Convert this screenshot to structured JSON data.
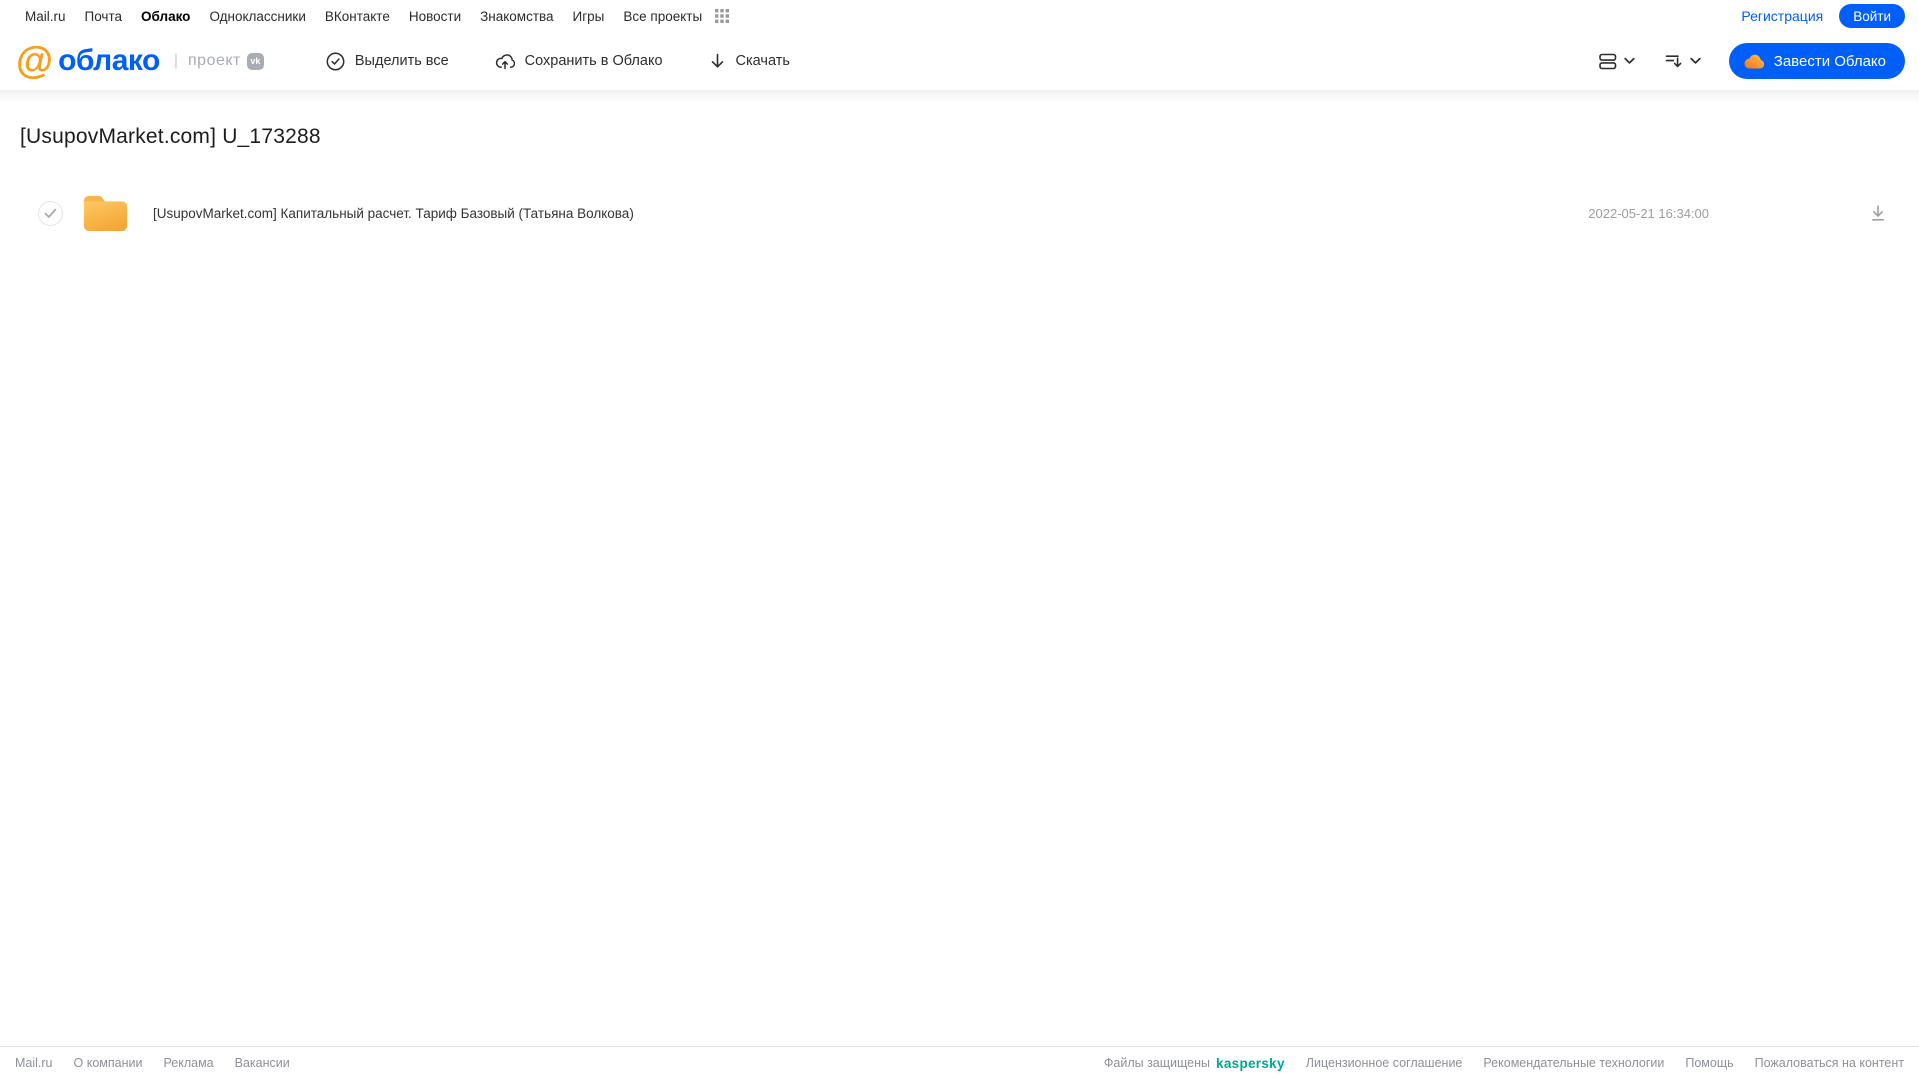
{
  "topnav": {
    "items": [
      "Mail.ru",
      "Почта",
      "Облако",
      "Одноклассники",
      "ВКонтакте",
      "Новости",
      "Знакомства",
      "Игры",
      "Все проекты"
    ],
    "active_item": "Облако",
    "registration_label": "Регистрация",
    "login_label": "Войти"
  },
  "header": {
    "logo": {
      "at_symbol": "@",
      "word": "облако",
      "project_label": "проект",
      "vk_badge": "vk"
    },
    "actions": [
      {
        "label": "Выделить все",
        "icon": "check-circle-icon"
      },
      {
        "label": "Сохранить в Облако",
        "icon": "cloud-upload-icon"
      },
      {
        "label": "Скачать",
        "icon": "download-arrow-icon"
      }
    ],
    "create_cloud_button": {
      "label": "Завести Облако",
      "icon": "cloud-icon"
    }
  },
  "page": {
    "title": "[UsupovMarket.com] U_173288"
  },
  "files": [
    {
      "type": "folder",
      "name": "[UsupovMarket.com] Капитальный расчет. Тариф Базовый (Татьяна Волкова)",
      "date": "2022-05-21 16:34:00"
    }
  ],
  "footer": {
    "left_links": [
      "Mail.ru",
      "О компании",
      "Реклама",
      "Вакансии"
    ],
    "protected_text": "Файлы защищены",
    "kaspersky_label": "kaspersky",
    "right_links": [
      "Лицензионное соглашение",
      "Рекомендательные технологии",
      "Помощь",
      "Пожаловаться на контент"
    ]
  },
  "colors": {
    "accent_blue": "#005FF9",
    "logo_orange": "#F79E1B",
    "folder_yellow": "#F9B13F",
    "kaspersky_teal": "#00A88E"
  }
}
